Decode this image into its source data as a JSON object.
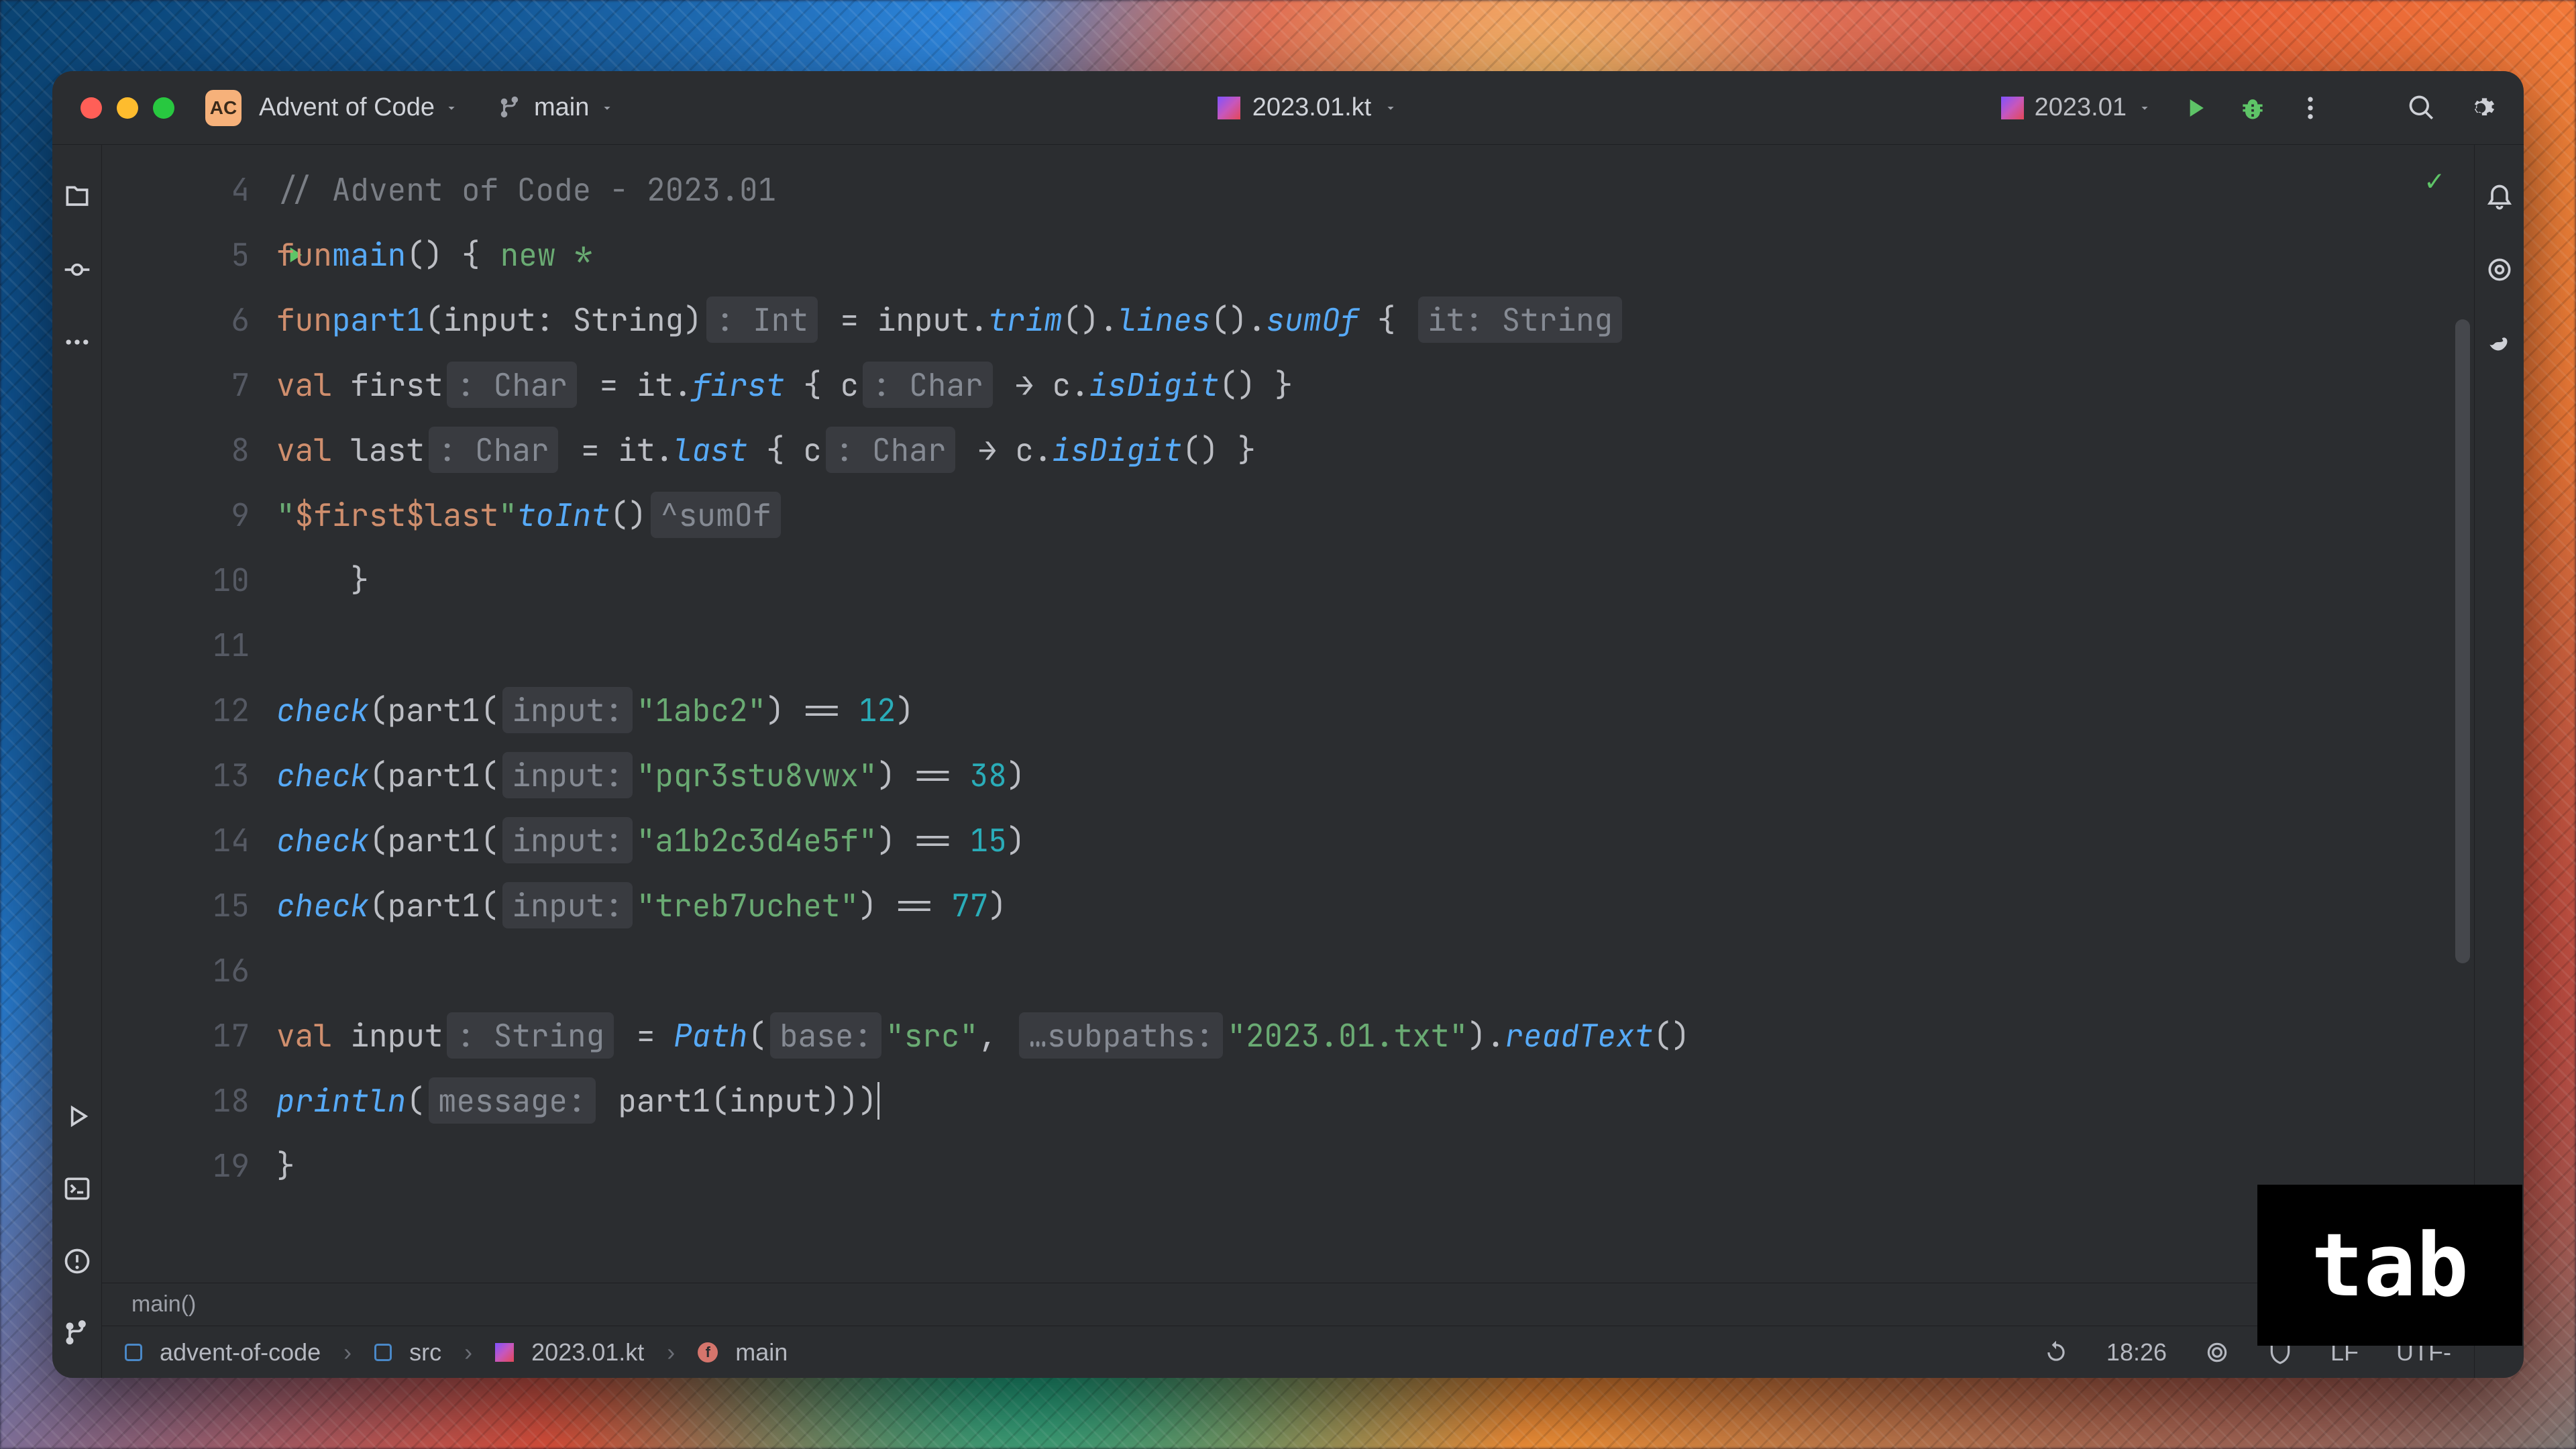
{
  "titlebar": {
    "project_badge": "AC",
    "project_name": "Advent of Code",
    "branch": "main",
    "file_name": "2023.01.kt",
    "run_config": "2023.01"
  },
  "gutter": [
    "4",
    "5",
    "6",
    "7",
    "8",
    "9",
    "10",
    "11",
    "12",
    "13",
    "14",
    "15",
    "16",
    "17",
    "18",
    "19"
  ],
  "code": {
    "l4_comment": "// Advent of Code - 2023.01",
    "l5": {
      "fun": "fun",
      "main": "main",
      "new": "new *"
    },
    "l6": {
      "fun": "fun",
      "part1": "part1",
      "params": "(input: String)",
      "hint": ": Int",
      "eq": " = input.",
      "trim": "trim",
      "lines": "lines",
      "sumOf": "sumOf",
      "it": "it: String"
    },
    "l7": {
      "val": "val",
      "name": " first",
      "hint": ": Char",
      "eq": " = it.",
      "first": "first",
      "lb": " { c",
      "chint": ": Char",
      "arrow": " → c.",
      "isDigit": "isDigit",
      "end": "() }"
    },
    "l8": {
      "val": "val",
      "name": " last",
      "hint": ": Char",
      "eq": " = it.",
      "last": "last",
      "lb": " { c",
      "chint": ": Char",
      "arrow": " → c.",
      "isDigit": "isDigit",
      "end": "() }"
    },
    "l9": {
      "open": "\"",
      "t1": "$first$last",
      "close": "\"",
      ".": ".",
      "toInt": "toInt",
      "p": "()",
      "hint": "^sumOf"
    },
    "l12": {
      "check": "check",
      "open": "(part1(",
      "hint": "input:",
      "str": "\"1abc2\"",
      "close": ") == ",
      "num": "12",
      ")": ")"
    },
    "l13": {
      "check": "check",
      "open": "(part1(",
      "hint": "input:",
      "str": "\"pqr3stu8vwx\"",
      "close": ") == ",
      "num": "38",
      ")": ")"
    },
    "l14": {
      "check": "check",
      "open": "(part1(",
      "hint": "input:",
      "str": "\"a1b2c3d4e5f\"",
      "close": ") == ",
      "num": "15",
      ")": ")"
    },
    "l15": {
      "check": "check",
      "open": "(part1(",
      "hint": "input:",
      "str": "\"treb7uchet\"",
      "close": ") == ",
      "num": "77",
      ")": ")"
    },
    "l17": {
      "val": "val",
      "name": " input",
      "hint": ": String",
      "eq": " = ",
      "Path": "Path",
      "ph1": "base:",
      "s1": "\"src\"",
      "c": ", ",
      "ph2": "…subpaths:",
      "s2": "\"2023.01.txt\"",
      "close": ").",
      "read": "readText",
      "p": "()"
    },
    "l18": {
      "println": "println",
      "open": "(",
      "hint": "message:",
      "body": " part1(input))",
      ")": ")"
    }
  },
  "crumb_context": "main()",
  "breadcrumbs": {
    "p1": "advent-of-code",
    "p2": "src",
    "p3": "2023.01.kt",
    "p4": "main"
  },
  "status": {
    "caret": "18:26",
    "line_sep": "LF",
    "encoding": "UTF-"
  },
  "overlay_key": "tab"
}
